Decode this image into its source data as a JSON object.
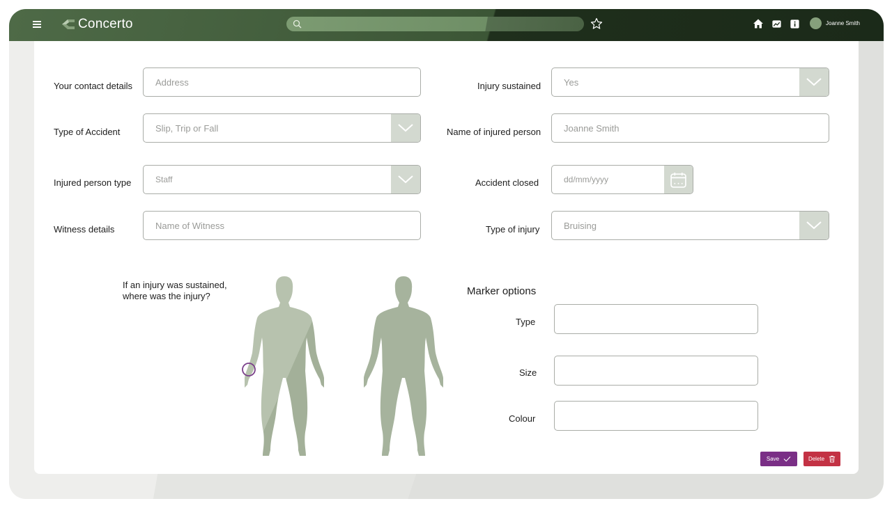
{
  "app": {
    "name": "Concerto",
    "user_name": "Joanne Smith"
  },
  "search": {
    "placeholder": ""
  },
  "top_icons": [
    "home-icon",
    "chart-icon",
    "info-icon"
  ],
  "colors": {
    "brand_green": "#4e6a47",
    "dark_green": "#1b2a19",
    "figure_green": "#a6b39d",
    "save_purple": "#7a2f86",
    "delete_red": "#c33244",
    "marker_purple": "#7a3f8a"
  },
  "form": {
    "contact": {
      "label": "Your contact details",
      "placeholder": "Address"
    },
    "accident_type": {
      "label": "Type of Accident",
      "value": "Slip, Trip or Fall"
    },
    "person_type": {
      "label": "Injured person type",
      "value": "Staff"
    },
    "witness": {
      "label": "Witness details",
      "placeholder": "Name of Witness"
    },
    "injury_sustained": {
      "label": "Injury sustained",
      "value": "Yes"
    },
    "injured_name": {
      "label": "Name of injured person",
      "value": "Joanne Smith"
    },
    "accident_closed": {
      "label": "Accident closed",
      "placeholder": "dd/mm/yyyy"
    },
    "injury_type": {
      "label": "Type of injury",
      "value": "Bruising"
    }
  },
  "body_map": {
    "question_line1": "If an injury was sustained,",
    "question_line2": "where was the injury?"
  },
  "marker_options": {
    "title": "Marker options",
    "type_label": "Type",
    "size_label": "Size",
    "colour_label": "Colour"
  },
  "actions": {
    "save_label": "Save",
    "delete_label": "Delete"
  }
}
